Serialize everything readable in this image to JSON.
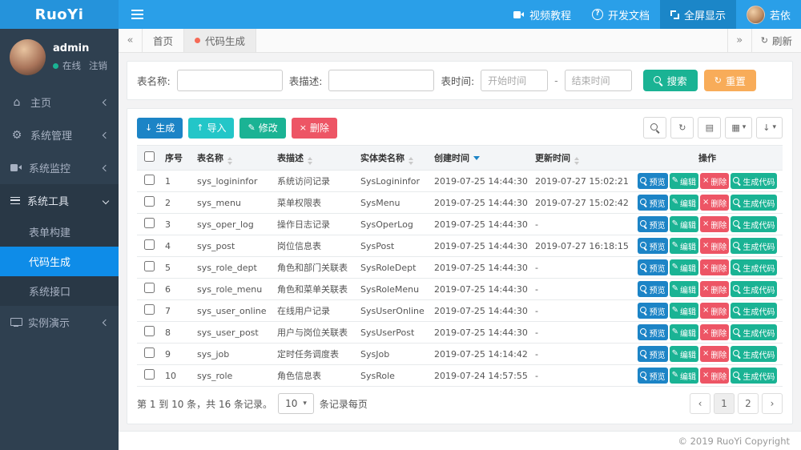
{
  "app": {
    "logo": "RuoYi",
    "footer": "© 2019 RuoYi Copyright"
  },
  "topnav": {
    "video": "视频教程",
    "docs": "开发文档",
    "fullscreen": "全屏显示",
    "username": "若依"
  },
  "sidebar": {
    "user": {
      "name": "admin",
      "status": "在线",
      "logout": "注销"
    },
    "items": [
      {
        "label": "主页"
      },
      {
        "label": "系统管理"
      },
      {
        "label": "系统监控"
      },
      {
        "label": "系统工具"
      },
      {
        "label": "实例演示"
      }
    ],
    "tools_children": [
      {
        "label": "表单构建"
      },
      {
        "label": "代码生成"
      },
      {
        "label": "系统接口"
      }
    ]
  },
  "tabbar": {
    "tabs": [
      {
        "label": "首页"
      },
      {
        "label": "代码生成"
      }
    ],
    "refresh_label": "刷新"
  },
  "search": {
    "name_label": "表名称:",
    "desc_label": "表描述:",
    "time_label": "表时间:",
    "start_placeholder": "开始时间",
    "end_placeholder": "结束时间",
    "time_separator": "-",
    "search_btn": "搜索",
    "reset_btn": "重置"
  },
  "toolbar": {
    "generate": "生成",
    "import": "导入",
    "modify": "修改",
    "delete": "删除"
  },
  "table": {
    "columns": [
      "序号",
      "表名称",
      "表描述",
      "实体类名称",
      "创建时间",
      "更新时间",
      "操作"
    ],
    "actions": {
      "preview": "预览",
      "edit": "编辑",
      "delete": "删除",
      "gen": "生成代码"
    },
    "rows": [
      {
        "index": "1",
        "name": "sys_logininfor",
        "desc": "系统访问记录",
        "entity": "SysLogininfor",
        "created": "2019-07-25 14:44:30",
        "updated": "2019-07-27 15:02:21"
      },
      {
        "index": "2",
        "name": "sys_menu",
        "desc": "菜单权限表",
        "entity": "SysMenu",
        "created": "2019-07-25 14:44:30",
        "updated": "2019-07-27 15:02:42"
      },
      {
        "index": "3",
        "name": "sys_oper_log",
        "desc": "操作日志记录",
        "entity": "SysOperLog",
        "created": "2019-07-25 14:44:30",
        "updated": "-"
      },
      {
        "index": "4",
        "name": "sys_post",
        "desc": "岗位信息表",
        "entity": "SysPost",
        "created": "2019-07-25 14:44:30",
        "updated": "2019-07-27 16:18:15"
      },
      {
        "index": "5",
        "name": "sys_role_dept",
        "desc": "角色和部门关联表",
        "entity": "SysRoleDept",
        "created": "2019-07-25 14:44:30",
        "updated": "-"
      },
      {
        "index": "6",
        "name": "sys_role_menu",
        "desc": "角色和菜单关联表",
        "entity": "SysRoleMenu",
        "created": "2019-07-25 14:44:30",
        "updated": "-"
      },
      {
        "index": "7",
        "name": "sys_user_online",
        "desc": "在线用户记录",
        "entity": "SysUserOnline",
        "created": "2019-07-25 14:44:30",
        "updated": "-"
      },
      {
        "index": "8",
        "name": "sys_user_post",
        "desc": "用户与岗位关联表",
        "entity": "SysUserPost",
        "created": "2019-07-25 14:44:30",
        "updated": "-"
      },
      {
        "index": "9",
        "name": "sys_job",
        "desc": "定时任务调度表",
        "entity": "SysJob",
        "created": "2019-07-25 14:14:42",
        "updated": "-"
      },
      {
        "index": "10",
        "name": "sys_role",
        "desc": "角色信息表",
        "entity": "SysRole",
        "created": "2019-07-24 14:57:55",
        "updated": "-"
      }
    ]
  },
  "pagination": {
    "info": "第 1 到 10 条，共 16 条记录。",
    "page_size": "10",
    "per_page_suffix": "条记录每页",
    "pages": [
      "1",
      "2"
    ]
  },
  "icons": {
    "home": "⌂",
    "gear": "⚙",
    "refresh": "↻",
    "edit": "✎",
    "close": "×",
    "download": "↓",
    "upload": "↑",
    "export": "↓",
    "caret_down": "▾",
    "back": "«",
    "forward": "»",
    "prev": "‹",
    "next": "›",
    "grid": "▦",
    "list": "▤"
  },
  "colors": {
    "header_blue": "#2a9fe8",
    "logo_blue": "#2593db",
    "sidebar_dark": "#2f4050",
    "submenu_dark": "#293846",
    "active_menu_blue": "#0e8ce8",
    "primary": "#1c84c6",
    "success": "#1ab394",
    "info": "#23c6c8",
    "warning": "#f8ac59",
    "danger": "#ed5565"
  }
}
